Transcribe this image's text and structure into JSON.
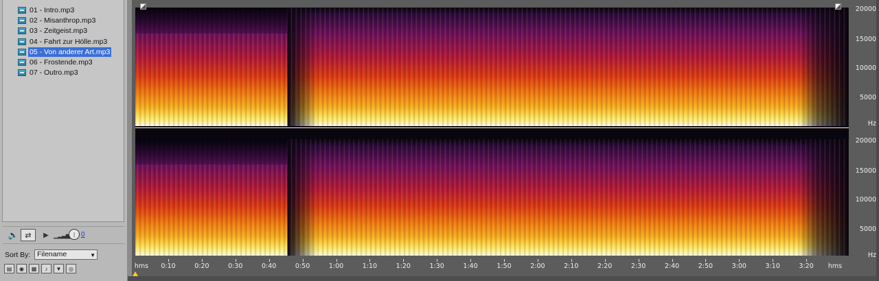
{
  "files": [
    {
      "label": "01 - Intro.mp3",
      "selected": false
    },
    {
      "label": "02 - Misanthrop.mp3",
      "selected": false
    },
    {
      "label": "03 - Zeitgeist.mp3",
      "selected": false
    },
    {
      "label": "04 - Fahrt zur Hölle.mp3",
      "selected": false
    },
    {
      "label": "05 - Von anderer Art.mp3",
      "selected": true
    },
    {
      "label": "06 - Frostende.mp3",
      "selected": false
    },
    {
      "label": "07 - Outro.mp3",
      "selected": false
    }
  ],
  "transport": {
    "volume_value": "0"
  },
  "sort": {
    "label": "Sort By:",
    "value": "Filename"
  },
  "frequency_axis": {
    "unit": "Hz",
    "ticks": [
      "20000",
      "15000",
      "10000",
      "5000"
    ]
  },
  "time_ruler": {
    "start_label": "hms",
    "end_label": "hms",
    "ticks": [
      "0:10",
      "0:20",
      "0:30",
      "0:40",
      "0:50",
      "1:00",
      "1:10",
      "1:20",
      "1:30",
      "1:40",
      "1:50",
      "2:00",
      "2:10",
      "2:20",
      "2:30",
      "2:40",
      "2:50",
      "3:00",
      "3:10",
      "3:20"
    ]
  },
  "colors": {
    "selection": "#3a6fd8",
    "panel_bg": "#c6c6c6",
    "cursor_marker": "#ffd11a"
  }
}
